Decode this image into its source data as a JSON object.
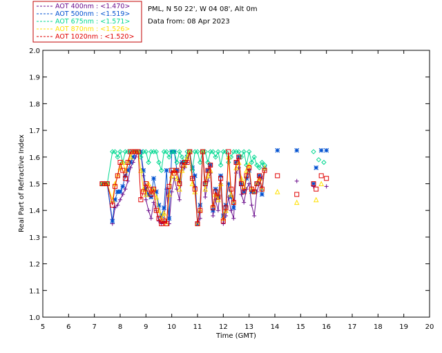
{
  "chart_data": {
    "type": "line",
    "header": {
      "site": "PML, N 50 22', W 04 08', Alt 0m",
      "date": "Data from: 08 Apr 2023"
    },
    "xlabel": "Time (GMT)",
    "ylabel": "Real Part of Refractive Index",
    "xlim": [
      5,
      20
    ],
    "ylim": [
      1.0,
      2.0
    ],
    "xticks": [
      5,
      6,
      7,
      8,
      9,
      10,
      11,
      12,
      13,
      14,
      15,
      16,
      17,
      18,
      19,
      20
    ],
    "yticks": [
      1.0,
      1.1,
      1.2,
      1.3,
      1.4,
      1.5,
      1.6,
      1.7,
      1.8,
      1.9,
      2.0
    ],
    "legend": [
      {
        "label": "AOT  400nm : <1.470>",
        "color": "#6a0d8c"
      },
      {
        "label": "AOT  500nm : <1.519>",
        "color": "#0050d0"
      },
      {
        "label": "AOT  675nm : <1.571>",
        "color": "#00d890"
      },
      {
        "label": "AOT  870nm : <1.526>",
        "color": "#ffe000"
      },
      {
        "label": "AOT 1020nm : <1.520>",
        "color": "#e00000"
      }
    ],
    "series": [
      {
        "name": "AOT  400nm : <1.470>",
        "color": "#6a0d8c",
        "marker": "plus",
        "x": [
          7.3,
          7.4,
          7.5,
          7.7,
          7.8,
          7.9,
          8.0,
          8.1,
          8.2,
          8.3,
          8.4,
          8.5,
          8.6,
          8.7,
          8.8,
          8.9,
          9.0,
          9.1,
          9.2,
          9.3,
          9.4,
          9.5,
          9.6,
          9.7,
          9.8,
          9.9,
          10.0,
          10.1,
          10.2,
          10.3,
          10.4,
          10.5,
          10.6,
          10.7,
          10.8,
          10.9,
          11.0,
          11.1,
          11.2,
          11.3,
          11.4,
          11.5,
          11.6,
          11.7,
          11.8,
          11.9,
          12.0,
          12.1,
          12.2,
          12.3,
          12.4,
          12.5,
          12.6,
          12.7,
          12.8,
          12.9,
          13.0,
          13.1,
          13.2,
          13.3,
          13.4,
          13.5,
          13.6
        ],
        "y": [
          1.5,
          1.5,
          1.5,
          1.35,
          1.41,
          1.42,
          1.44,
          1.46,
          1.48,
          1.51,
          1.56,
          1.58,
          1.6,
          1.62,
          1.62,
          1.53,
          1.44,
          1.4,
          1.37,
          1.43,
          1.4,
          1.36,
          1.35,
          1.36,
          1.48,
          1.35,
          1.47,
          1.52,
          1.48,
          1.44,
          1.55,
          1.56,
          1.58,
          1.62,
          1.52,
          1.49,
          1.35,
          1.37,
          1.62,
          1.45,
          1.51,
          1.54,
          1.38,
          1.44,
          1.4,
          1.5,
          1.35,
          1.38,
          1.45,
          1.4,
          1.37,
          1.54,
          1.56,
          1.46,
          1.43,
          1.48,
          1.5,
          1.42,
          1.38,
          1.47,
          1.5,
          1.52,
          1.55
        ]
      },
      {
        "name": "AOT  500nm : <1.519>",
        "color": "#0050d0",
        "marker": "asterisk",
        "x": [
          7.3,
          7.4,
          7.5,
          7.7,
          7.8,
          7.9,
          8.0,
          8.1,
          8.2,
          8.3,
          8.4,
          8.5,
          8.6,
          8.7,
          8.8,
          8.9,
          9.0,
          9.1,
          9.2,
          9.3,
          9.4,
          9.5,
          9.6,
          9.7,
          9.8,
          9.9,
          10.0,
          10.1,
          10.2,
          10.3,
          10.4,
          10.5,
          10.6,
          10.7,
          10.8,
          10.9,
          11.0,
          11.1,
          11.2,
          11.3,
          11.4,
          11.5,
          11.6,
          11.7,
          11.8,
          11.9,
          12.0,
          12.1,
          12.2,
          12.3,
          12.4,
          12.5,
          12.6,
          12.7,
          12.8,
          12.9,
          13.0,
          13.1,
          13.2,
          13.3,
          13.4,
          13.5,
          13.6
        ],
        "y": [
          1.5,
          1.5,
          1.5,
          1.36,
          1.44,
          1.47,
          1.47,
          1.49,
          1.53,
          1.55,
          1.58,
          1.6,
          1.62,
          1.62,
          1.62,
          1.55,
          1.48,
          1.46,
          1.45,
          1.52,
          1.47,
          1.42,
          1.38,
          1.41,
          1.55,
          1.37,
          1.62,
          1.62,
          1.55,
          1.51,
          1.58,
          1.58,
          1.6,
          1.62,
          1.56,
          1.53,
          1.35,
          1.42,
          1.62,
          1.5,
          1.55,
          1.57,
          1.4,
          1.48,
          1.45,
          1.53,
          1.38,
          1.42,
          1.5,
          1.45,
          1.41,
          1.58,
          1.6,
          1.5,
          1.47,
          1.52,
          1.55,
          1.47,
          1.47,
          1.5,
          1.53,
          1.46,
          1.56
        ]
      },
      {
        "name": "AOT  675nm : <1.571>",
        "color": "#00d890",
        "marker": "diamond",
        "x": [
          7.3,
          7.4,
          7.5,
          7.7,
          7.8,
          7.9,
          8.0,
          8.1,
          8.2,
          8.3,
          8.4,
          8.5,
          8.6,
          8.7,
          8.8,
          8.9,
          9.0,
          9.1,
          9.2,
          9.3,
          9.4,
          9.5,
          9.6,
          9.7,
          9.8,
          9.9,
          10.0,
          10.1,
          10.2,
          10.3,
          10.4,
          10.5,
          10.6,
          10.7,
          10.8,
          10.9,
          11.0,
          11.1,
          11.2,
          11.3,
          11.4,
          11.5,
          11.6,
          11.7,
          11.8,
          11.9,
          12.0,
          12.1,
          12.2,
          12.3,
          12.4,
          12.5,
          12.6,
          12.7,
          12.8,
          12.9,
          13.0,
          13.1,
          13.2,
          13.3,
          13.4,
          13.5,
          13.6
        ],
        "y": [
          1.5,
          1.5,
          1.5,
          1.62,
          1.62,
          1.6,
          1.62,
          1.58,
          1.62,
          1.62,
          1.62,
          1.62,
          1.62,
          1.62,
          1.6,
          1.62,
          1.62,
          1.58,
          1.62,
          1.62,
          1.62,
          1.58,
          1.55,
          1.62,
          1.62,
          1.6,
          1.62,
          1.62,
          1.58,
          1.62,
          1.6,
          1.58,
          1.62,
          1.62,
          1.55,
          1.62,
          1.62,
          1.58,
          1.62,
          1.62,
          1.58,
          1.62,
          1.62,
          1.6,
          1.62,
          1.57,
          1.62,
          1.62,
          1.58,
          1.6,
          1.62,
          1.62,
          1.62,
          1.6,
          1.62,
          1.57,
          1.62,
          1.58,
          1.6,
          1.57,
          1.56,
          1.58,
          1.57
        ]
      },
      {
        "name": "AOT  870nm : <1.526>",
        "color": "#ffe000",
        "marker": "triangle",
        "x": [
          7.3,
          7.4,
          7.5,
          7.7,
          7.8,
          7.9,
          8.0,
          8.1,
          8.2,
          8.3,
          8.4,
          8.5,
          8.6,
          8.7,
          8.8,
          8.9,
          9.0,
          9.1,
          9.2,
          9.3,
          9.4,
          9.5,
          9.6,
          9.7,
          9.8,
          9.9,
          10.0,
          10.1,
          10.2,
          10.3,
          10.4,
          10.5,
          10.6,
          10.7,
          10.8,
          10.9,
          11.0,
          11.1,
          11.2,
          11.3,
          11.4,
          11.5,
          11.6,
          11.7,
          11.8,
          11.9,
          12.0,
          12.1,
          12.2,
          12.3,
          12.4,
          12.5,
          12.6,
          12.7,
          12.8,
          12.9,
          13.0,
          13.1,
          13.2,
          13.3,
          13.4,
          13.5,
          13.6
        ],
        "y": [
          1.5,
          1.5,
          1.5,
          1.44,
          1.5,
          1.53,
          1.56,
          1.58,
          1.55,
          1.58,
          1.6,
          1.62,
          1.62,
          1.62,
          1.55,
          1.48,
          1.46,
          1.5,
          1.47,
          1.48,
          1.45,
          1.4,
          1.37,
          1.39,
          1.35,
          1.46,
          1.53,
          1.55,
          1.52,
          1.48,
          1.55,
          1.57,
          1.6,
          1.62,
          1.5,
          1.47,
          1.35,
          1.4,
          1.62,
          1.48,
          1.53,
          1.55,
          1.42,
          1.46,
          1.44,
          1.5,
          1.37,
          1.4,
          1.6,
          1.46,
          1.43,
          1.56,
          1.58,
          1.52,
          1.49,
          1.55,
          1.57,
          1.48,
          1.47,
          1.5,
          1.52,
          1.48,
          1.56
        ]
      },
      {
        "name": "AOT 1020nm : <1.520>",
        "color": "#e00000",
        "marker": "square",
        "x": [
          7.3,
          7.4,
          7.5,
          7.7,
          7.8,
          7.9,
          8.0,
          8.1,
          8.2,
          8.3,
          8.4,
          8.5,
          8.6,
          8.7,
          8.8,
          8.9,
          9.0,
          9.1,
          9.2,
          9.3,
          9.4,
          9.5,
          9.6,
          9.7,
          9.8,
          9.9,
          10.0,
          10.1,
          10.2,
          10.3,
          10.4,
          10.5,
          10.6,
          10.7,
          10.8,
          10.9,
          11.0,
          11.1,
          11.2,
          11.3,
          11.4,
          11.5,
          11.6,
          11.7,
          11.8,
          11.9,
          12.0,
          12.1,
          12.2,
          12.3,
          12.4,
          12.5,
          12.6,
          12.7,
          12.8,
          12.9,
          13.0,
          13.1,
          13.2,
          13.3,
          13.4,
          13.5,
          13.6
        ],
        "y": [
          1.5,
          1.5,
          1.5,
          1.42,
          1.49,
          1.53,
          1.58,
          1.55,
          1.52,
          1.58,
          1.62,
          1.62,
          1.62,
          1.62,
          1.44,
          1.47,
          1.5,
          1.48,
          1.46,
          1.48,
          1.4,
          1.37,
          1.35,
          1.36,
          1.35,
          1.49,
          1.55,
          1.54,
          1.55,
          1.5,
          1.57,
          1.58,
          1.58,
          1.62,
          1.52,
          1.48,
          1.35,
          1.4,
          1.62,
          1.5,
          1.55,
          1.57,
          1.41,
          1.47,
          1.45,
          1.52,
          1.36,
          1.41,
          1.62,
          1.48,
          1.43,
          1.58,
          1.6,
          1.5,
          1.47,
          1.53,
          1.56,
          1.48,
          1.47,
          1.5,
          1.53,
          1.48,
          1.55
        ]
      }
    ],
    "scatter_points": [
      {
        "series": 1,
        "x": 14.1,
        "y": 1.625
      },
      {
        "series": 1,
        "x": 14.85,
        "y": 1.625
      },
      {
        "series": 1,
        "x": 15.5,
        "y": 1.5
      },
      {
        "series": 1,
        "x": 15.6,
        "y": 1.56
      },
      {
        "series": 1,
        "x": 15.8,
        "y": 1.625
      },
      {
        "series": 1,
        "x": 16.0,
        "y": 1.625
      },
      {
        "series": 0,
        "x": 14.85,
        "y": 1.51
      },
      {
        "series": 0,
        "x": 15.5,
        "y": 1.49
      },
      {
        "series": 0,
        "x": 16.0,
        "y": 1.49
      },
      {
        "series": 2,
        "x": 15.5,
        "y": 1.62
      },
      {
        "series": 2,
        "x": 15.7,
        "y": 1.59
      },
      {
        "series": 2,
        "x": 15.9,
        "y": 1.58
      },
      {
        "series": 3,
        "x": 14.1,
        "y": 1.47
      },
      {
        "series": 3,
        "x": 14.85,
        "y": 1.43
      },
      {
        "series": 3,
        "x": 15.6,
        "y": 1.44
      },
      {
        "series": 3,
        "x": 15.8,
        "y": 1.5
      },
      {
        "series": 4,
        "x": 14.1,
        "y": 1.53
      },
      {
        "series": 4,
        "x": 14.85,
        "y": 1.46
      },
      {
        "series": 4,
        "x": 15.5,
        "y": 1.5
      },
      {
        "series": 4,
        "x": 15.6,
        "y": 1.48
      },
      {
        "series": 4,
        "x": 15.8,
        "y": 1.53
      },
      {
        "series": 4,
        "x": 16.0,
        "y": 1.52
      }
    ]
  }
}
